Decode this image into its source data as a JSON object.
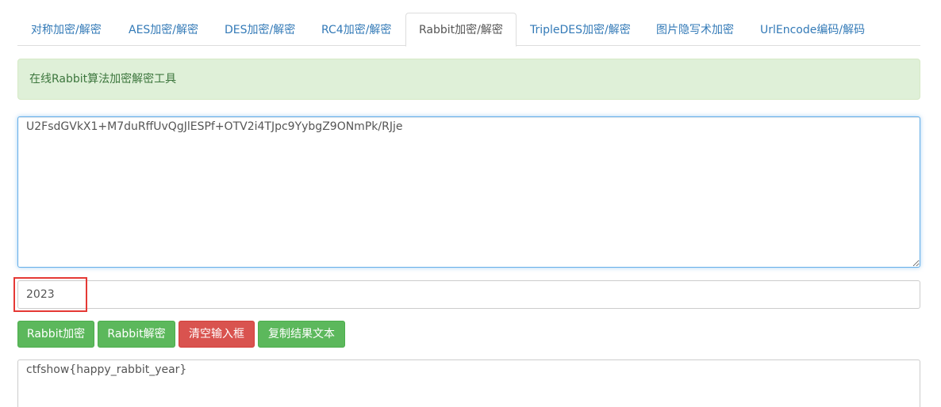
{
  "tabs": [
    {
      "label": "对称加密/解密"
    },
    {
      "label": "AES加密/解密"
    },
    {
      "label": "DES加密/解密"
    },
    {
      "label": "RC4加密/解密"
    },
    {
      "label": "Rabbit加密/解密",
      "active": true
    },
    {
      "label": "TripleDES加密/解密"
    },
    {
      "label": "图片隐写术加密"
    },
    {
      "label": "UrlEncode编码/解码"
    }
  ],
  "alert": {
    "text": "在线Rabbit算法加密解密工具"
  },
  "input": {
    "value": "U2FsdGVkX1+M7duRffUvQgJlESPf+OTV2i4TJpc9YybgZ9ONmPk/RJje"
  },
  "key": {
    "value": "2023"
  },
  "buttons": {
    "encrypt": "Rabbit加密",
    "decrypt": "Rabbit解密",
    "clear": "清空输入框",
    "copy": "复制结果文本"
  },
  "output": {
    "value": "ctfshow{happy_rabbit_year}"
  },
  "colors": {
    "link": "#337ab7",
    "success": "#5cb85c",
    "danger": "#d9534f",
    "alert_bg": "#dff0d8",
    "highlight": "#e53935"
  }
}
